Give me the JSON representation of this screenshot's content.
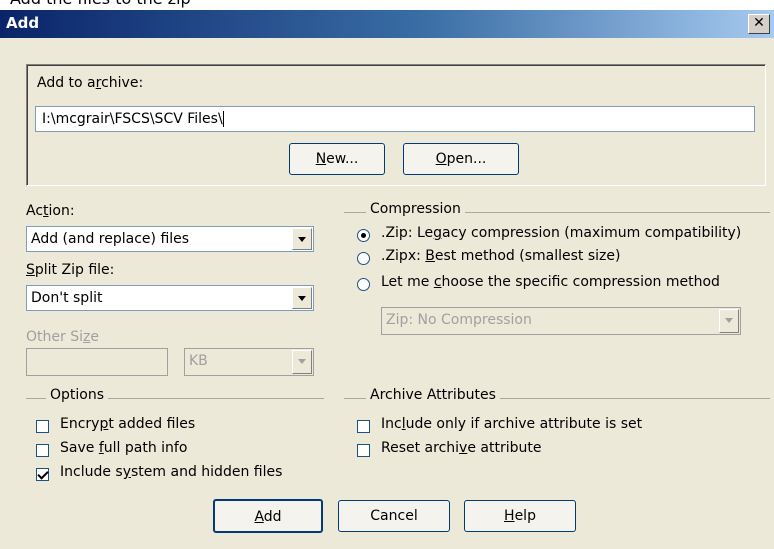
{
  "window": {
    "title": "Add",
    "partial_title_text": "Add the files to the zip"
  },
  "archive_group": {
    "label_parts": [
      "Add to a",
      "r",
      "chive:"
    ],
    "path_value": "I:\\mcgrair\\FSCS\\SCV Files\\",
    "new_button_parts": [
      "",
      "N",
      "ew..."
    ],
    "open_button_parts": [
      "",
      "O",
      "pen..."
    ]
  },
  "action": {
    "label_parts": [
      "Ac",
      "t",
      "ion:"
    ],
    "selected": "Add (and replace) files"
  },
  "split": {
    "label_parts": [
      "",
      "S",
      "plit Zip file:"
    ],
    "selected": "Don't split"
  },
  "other_size": {
    "label_parts": [
      "Other Si",
      "z",
      "e"
    ],
    "value": "",
    "unit": "KB"
  },
  "compression": {
    "group_title": "Compression",
    "options": [
      {
        "parts": [
          ".Zip: Le",
          "g",
          "acy compression (maximum compatibility)"
        ],
        "selected": true
      },
      {
        "parts": [
          ".Zipx: ",
          "B",
          "est method (smallest size)"
        ],
        "selected": false
      },
      {
        "parts": [
          "Let me ",
          "c",
          "hoose the specific compression method"
        ],
        "selected": false
      }
    ],
    "method_select": "Zip: No Compression"
  },
  "options": {
    "group_title": "Options",
    "items": [
      {
        "parts": [
          "Encry",
          "p",
          "t added files"
        ],
        "checked": false
      },
      {
        "parts": [
          "Save ",
          "f",
          "ull path info"
        ],
        "checked": false
      },
      {
        "parts": [
          "Include s",
          "y",
          "stem and hidden files"
        ],
        "checked": true
      }
    ]
  },
  "archive_attributes": {
    "group_title": "Archive Attributes",
    "items": [
      {
        "parts": [
          "Inc",
          "l",
          "ude only if archive attribute is set"
        ],
        "checked": false
      },
      {
        "parts": [
          "Reset archi",
          "v",
          "e attribute"
        ],
        "checked": false
      }
    ]
  },
  "buttons": {
    "add_parts": [
      "",
      "A",
      "dd"
    ],
    "cancel": "Cancel",
    "help_parts": [
      "",
      "H",
      "elp"
    ]
  }
}
